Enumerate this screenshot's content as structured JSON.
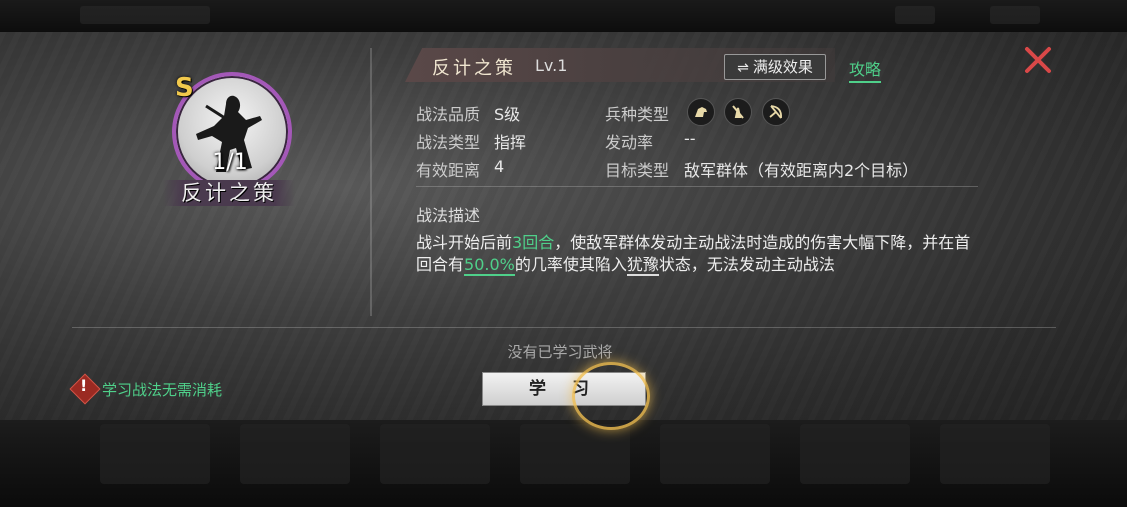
{
  "skill": {
    "name": "反计之策",
    "level": "Lv.1",
    "grade": "S",
    "count": "1/1"
  },
  "header": {
    "max_effect_label": "满级效果",
    "guide_label": "攻略"
  },
  "attributes": {
    "quality_label": "战法品质",
    "quality_value": "S级",
    "type_label": "战法类型",
    "type_value": "指挥",
    "range_label": "有效距离",
    "range_value": "4",
    "troop_label": "兵种类型",
    "rate_label": "发动率",
    "rate_value": "--",
    "target_label": "目标类型",
    "target_value": "敌军群体（有效距离内2个目标）"
  },
  "troop_icons": [
    "cavalry-icon",
    "infantry-icon",
    "archer-icon"
  ],
  "description": {
    "title": "战法描述",
    "part1": "战斗开始后前",
    "rounds": "3回合",
    "part2": "，使敌军群体发动主动战法时造成的伤害大幅下降，并在首回合有",
    "chance": "50.0%",
    "part3": "的几率使其陷入",
    "status": "犹豫",
    "part4": "状态，无法发动主动战法"
  },
  "footer": {
    "no_learned": "没有已学习武将",
    "cost_note": "学习战法无需消耗",
    "learn_button": "学 习"
  },
  "colors": {
    "accent_green": "#4fd08a",
    "close_red": "#d94848",
    "portrait_ring": "#a458b8",
    "grade_gold": "#f2c94c"
  }
}
